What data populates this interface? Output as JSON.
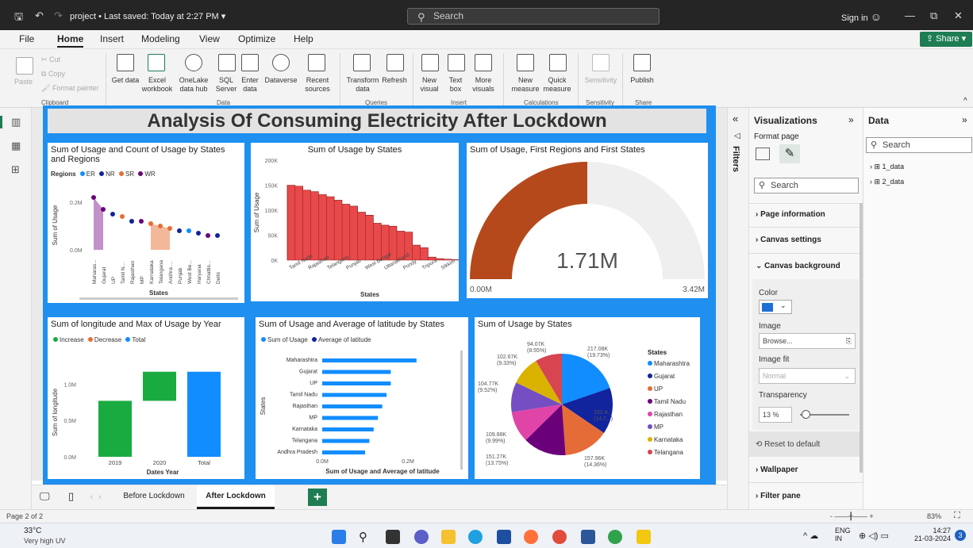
{
  "window": {
    "project": "project",
    "saved": "Last saved: Today at 2:27 PM",
    "search_placeholder": "Search",
    "signin": "Sign in"
  },
  "menu": [
    "File",
    "Home",
    "Insert",
    "Modeling",
    "View",
    "Optimize",
    "Help"
  ],
  "share": "Share",
  "ribbon": {
    "clipboard": {
      "paste": "Paste",
      "cut": "Cut",
      "copy": "Copy",
      "format_painter": "Format painter",
      "group": "Clipboard"
    },
    "data": {
      "items": [
        "Get data",
        "Excel workbook",
        "OneLake data hub",
        "SQL Server",
        "Enter data",
        "Dataverse",
        "Recent sources"
      ],
      "group": "Data"
    },
    "queries": {
      "items": [
        "Transform data",
        "Refresh"
      ],
      "group": "Queries"
    },
    "insert": {
      "items": [
        "New visual",
        "Text box",
        "More visuals"
      ],
      "group": "Insert"
    },
    "calculations": {
      "items": [
        "New measure",
        "Quick measure"
      ],
      "group": "Calculations"
    },
    "sensitivity": {
      "items": [
        "Sensitivity"
      ],
      "group": "Sensitivity"
    },
    "share": {
      "items": [
        "Publish"
      ],
      "group": "Share"
    }
  },
  "report_title": "Analysis Of Consuming Electricity After Lockdown",
  "tabs": [
    "Before Lockdown",
    "After Lockdown"
  ],
  "colors": {
    "canvas": "#1f8ff0",
    "green": "#1e7d53",
    "accent_blue": "#118dff"
  },
  "filters_label": "Filters",
  "viz_pane": {
    "title": "Visualizations",
    "format_page": "Format page",
    "search": "Search",
    "sections": [
      "Page information",
      "Canvas settings",
      "Canvas background",
      "Wallpaper",
      "Filter pane"
    ],
    "color_label": "Color",
    "image_label": "Image",
    "browse": "Browse...",
    "image_fit_label": "Image fit",
    "image_fit": "Normal",
    "transparency_label": "Transparency",
    "transparency": "13 %",
    "reset": "Reset to default"
  },
  "data_pane": {
    "title": "Data",
    "search": "Search",
    "tables": [
      "1_data",
      "2_data"
    ]
  },
  "status": {
    "page": "Page 2 of 2",
    "zoom": "83%"
  },
  "taskbar": {
    "temp": "33°C",
    "weather": "Very high UV",
    "lang1": "ENG",
    "lang2": "IN",
    "time": "14:27",
    "date": "21-03-2024",
    "badge": "3"
  },
  "chart_data": [
    {
      "type": "scatter",
      "title": "Sum of Usage and Count of Usage by States and Regions",
      "legend_title": "Regions",
      "legend": [
        "ER",
        "NR",
        "SR",
        "WR"
      ],
      "legend_colors": [
        "#118dff",
        "#12239e",
        "#e66c37",
        "#6b007b"
      ],
      "categories": [
        "Maharashtra",
        "Gujarat",
        "UP",
        "Tamil Nadu",
        "Rajasthan",
        "MP",
        "Karnataka",
        "Telangana",
        "Andhra Pradesh",
        "Punjab",
        "West Bengal",
        "Haryana",
        "Chhattisgarh",
        "Delhi"
      ],
      "category_labels": [
        "Maharas...",
        "Gujarat",
        "UP",
        "Tamil N...",
        "Rajasthan",
        "MP",
        "Karnataka",
        "Telangana",
        "Andhra ...",
        "Punjab",
        "West Be...",
        "Haryana",
        "Chhattis...",
        "Delhi"
      ],
      "values": [
        0.22,
        0.17,
        0.15,
        0.14,
        0.12,
        0.12,
        0.11,
        0.1,
        0.09,
        0.08,
        0.08,
        0.07,
        0.06,
        0.06
      ],
      "point_colors": [
        "#6b007b",
        "#6b007b",
        "#12239e",
        "#e66c37",
        "#12239e",
        "#6b007b",
        "#e66c37",
        "#e66c37",
        "#e66c37",
        "#12239e",
        "#118dff",
        "#12239e",
        "#6b007b",
        "#12239e"
      ],
      "xlabel": "States",
      "ylabel": "Sum of Usage",
      "yticks": [
        "0.2M",
        "0.0M"
      ]
    },
    {
      "type": "area",
      "title": "Sum of Usage by States",
      "categories": [
        "Tamil Nadu",
        "Rajasthan",
        "Telangana",
        "Punjab",
        "West Bengal",
        "Uttarakhand",
        "Pondy",
        "Tripura",
        "Sikkim"
      ],
      "values": [
        150000,
        148000,
        140000,
        137000,
        131000,
        127000,
        120000,
        112000,
        108000,
        96000,
        90000,
        74000,
        70000,
        68000,
        58000,
        56000,
        30000,
        25000,
        6000,
        3000,
        2000,
        1000
      ],
      "xlabel": "States",
      "ylabel": "Sum of Usage",
      "yticks": [
        "0K",
        "50K",
        "100K",
        "150K",
        "200K"
      ],
      "ylim": [
        0,
        200000
      ]
    },
    {
      "type": "gauge",
      "title": "Sum of Usage, First Regions and First States",
      "value_label": "1.71M",
      "value": 1.71,
      "min": "0.00M",
      "max": "3.42M"
    },
    {
      "type": "waterfall",
      "title": "Sum of longitude and Max of Usage by Year",
      "legend": [
        "Increase",
        "Decrease",
        "Total"
      ],
      "legend_colors": [
        "#1aab40",
        "#e66c37",
        "#118dff"
      ],
      "categories": [
        "2019",
        "2020",
        "Total"
      ],
      "values": [
        0.77,
        0.4,
        1.17
      ],
      "xlabel": "Dates Year",
      "ylabel": "Sum of longitude",
      "yticks": [
        "0.0M",
        "0.5M",
        "1.0M"
      ]
    },
    {
      "type": "bar",
      "title": "Sum of Usage and Average of latitude by States",
      "legend": [
        "Sum of Usage",
        "Average of latitude"
      ],
      "legend_colors": [
        "#118dff",
        "#12239e"
      ],
      "categories": [
        "Maharashtra",
        "Gujarat",
        "UP",
        "Tamil Nadu",
        "Rajasthan",
        "MP",
        "Karnataka",
        "Telangana",
        "Andhra Pradesh"
      ],
      "values": [
        0.22,
        0.16,
        0.16,
        0.15,
        0.14,
        0.13,
        0.12,
        0.11,
        0.1
      ],
      "xlabel": "Sum of Usage and Average of latitude",
      "ylabel": "States",
      "xticks": [
        "0.0M",
        "0.2M"
      ]
    },
    {
      "type": "pie",
      "title": "Sum of Usage by States",
      "legend_title": "States",
      "legend": [
        "Maharashtra",
        "Gujarat",
        "UP",
        "Tamil Nadu",
        "Rajasthan",
        "MP",
        "Karnataka",
        "Telangana"
      ],
      "colors": [
        "#118dff",
        "#12239e",
        "#e66c37",
        "#6b007b",
        "#e044a7",
        "#744ec2",
        "#d9b300",
        "#d64550"
      ],
      "values": [
        217.08,
        162.4,
        157.96,
        151.27,
        109.88,
        104.77,
        102.67,
        94.07
      ],
      "labels": [
        "217.08K (19.73%)",
        "162.4... (14.7...)",
        "157.96K (14.36%)",
        "151.27K (13.75%)",
        "109.88K (9.99%)",
        "104.77K (9.52%)",
        "102.67K (9.33%)",
        "94.07K (8.55%)"
      ]
    }
  ]
}
